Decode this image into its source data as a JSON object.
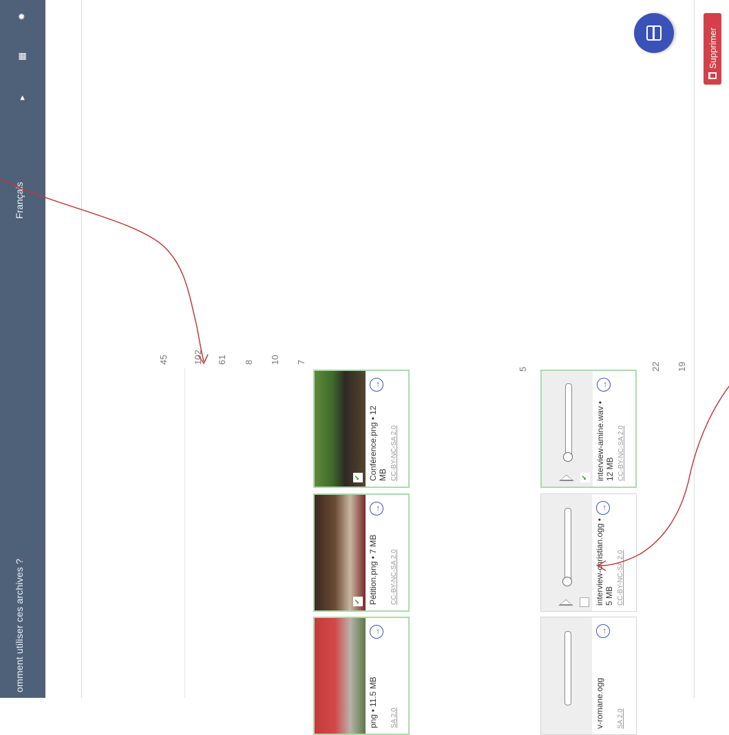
{
  "nav": {
    "help_text": "omment utiliser ces archives ?",
    "language": "Français",
    "icons": [
      "chevron-right-icon",
      "grid-icon",
      "gear-icon"
    ]
  },
  "actions": {
    "delete_label": "Supprimer",
    "fab_icon": "layout-toggle-icon"
  },
  "counts_top": [
    "45",
    "102",
    "61",
    "8",
    "10",
    "7"
  ],
  "counts_mid": [
    "5"
  ],
  "counts_bottom": [
    "22",
    "19"
  ],
  "images": [
    {
      "name": "Conférence.png • 12 MB",
      "license": "CC-BY-NC-SA 2.0",
      "checked": true
    },
    {
      "name": "Pétition.png • 7 MB",
      "license": "CC-BY-NC-SA 2.0",
      "checked": true
    },
    {
      "name": "png • 11.5 MB",
      "license": "SA 2.0",
      "checked": false
    }
  ],
  "audios": [
    {
      "name": "interview-amine.wav • 12 MB",
      "license": "CC-BY-NC-SA 2.0",
      "checked": true
    },
    {
      "name": "interview-christian.ogg • 5 MB",
      "license": "CC-BY-NC-SA 2.0",
      "checked": false
    },
    {
      "name": "v-romane.ogg",
      "license": "SA 2.0",
      "checked": false
    }
  ],
  "colors": {
    "nav": "#4f6079",
    "accent": "#3a52b8",
    "danger": "#d4404a",
    "selected_border": "#a8dca8",
    "annotation": "#c0393b"
  }
}
